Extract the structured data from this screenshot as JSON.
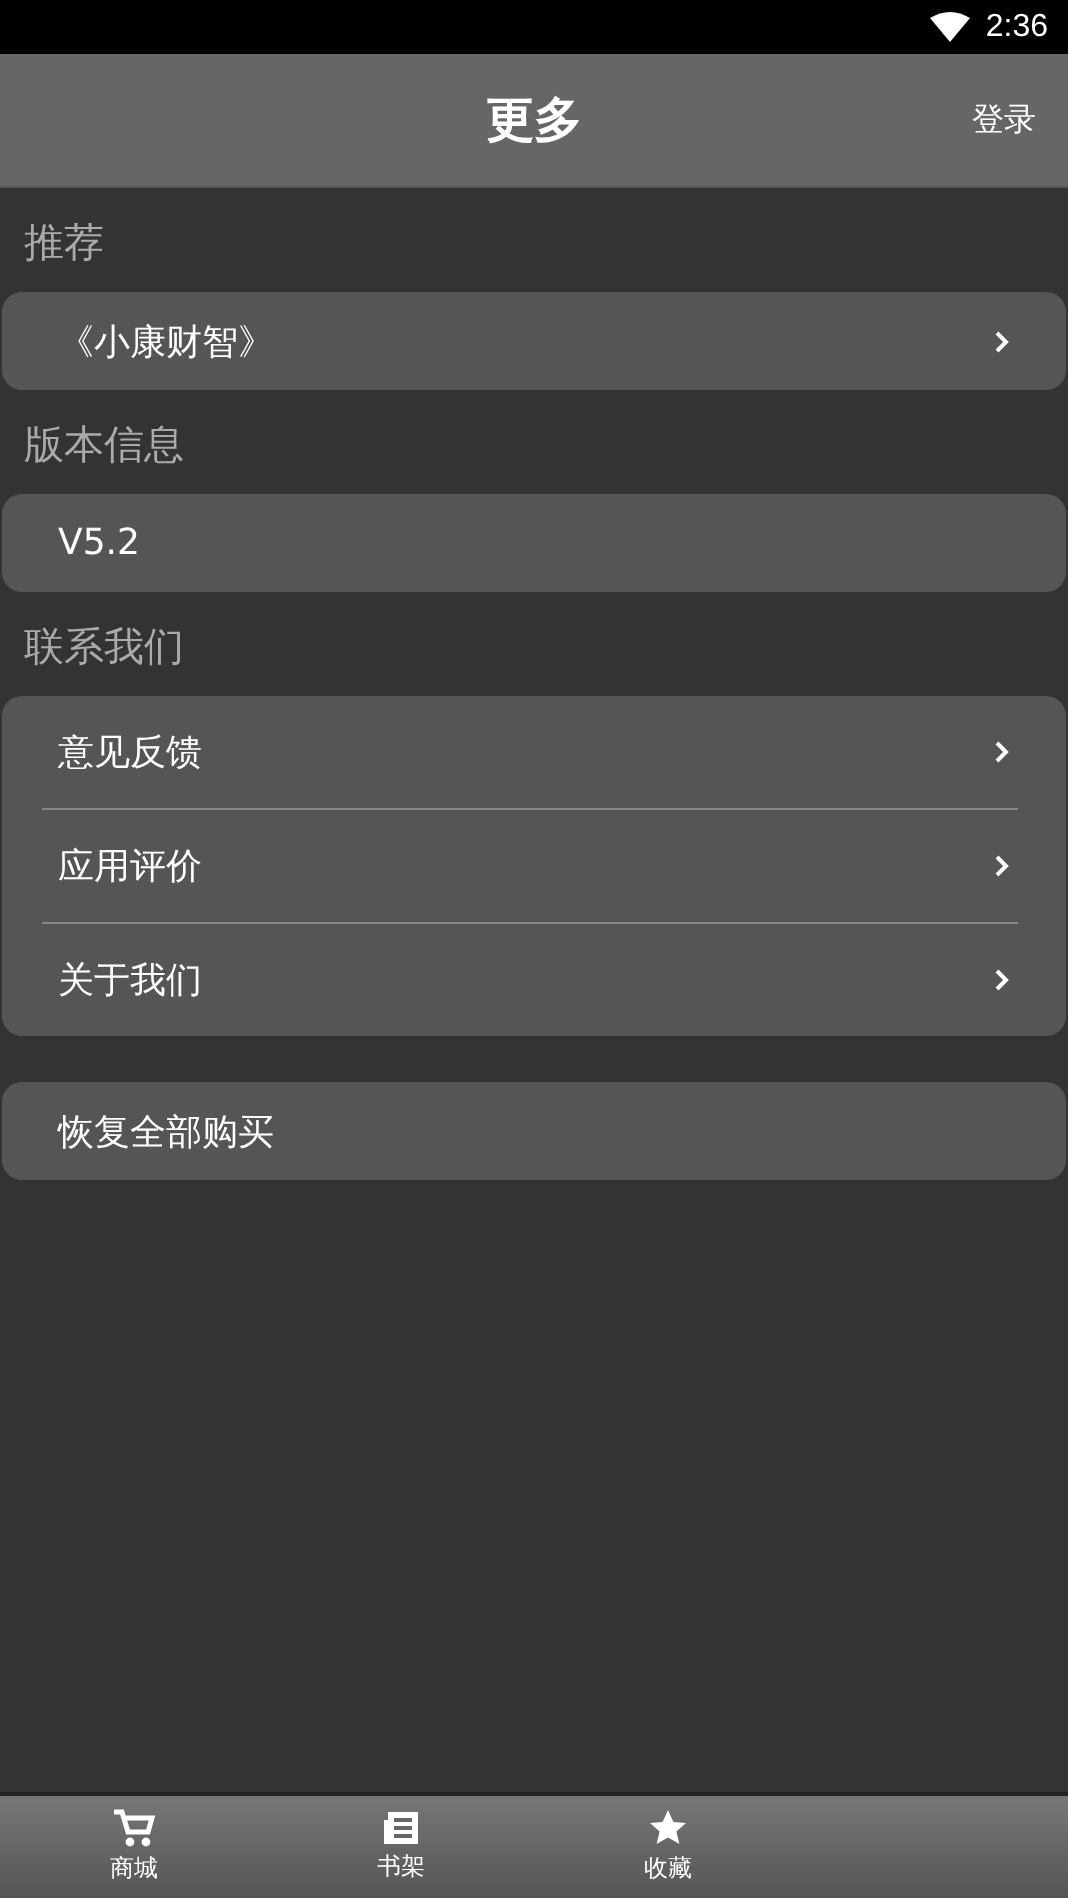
{
  "status_bar": {
    "time": "2:36"
  },
  "header": {
    "title": "更多",
    "action": "登录"
  },
  "sections": [
    {
      "label": "推荐",
      "items": [
        {
          "text": "《小康财智》",
          "chevron": true
        }
      ]
    },
    {
      "label": "版本信息",
      "items": [
        {
          "text": "V5.2",
          "chevron": false
        }
      ]
    },
    {
      "label": "联系我们",
      "items": [
        {
          "text": "意见反馈",
          "chevron": true
        },
        {
          "text": "应用评价",
          "chevron": true
        },
        {
          "text": "关于我们",
          "chevron": true
        }
      ]
    },
    {
      "items": [
        {
          "text": "恢复全部购买",
          "chevron": false
        }
      ]
    }
  ],
  "bottom_nav": [
    {
      "label": "商城",
      "kind": "cart"
    },
    {
      "label": "书架",
      "kind": "shelf"
    },
    {
      "label": "收藏",
      "kind": "star"
    }
  ]
}
